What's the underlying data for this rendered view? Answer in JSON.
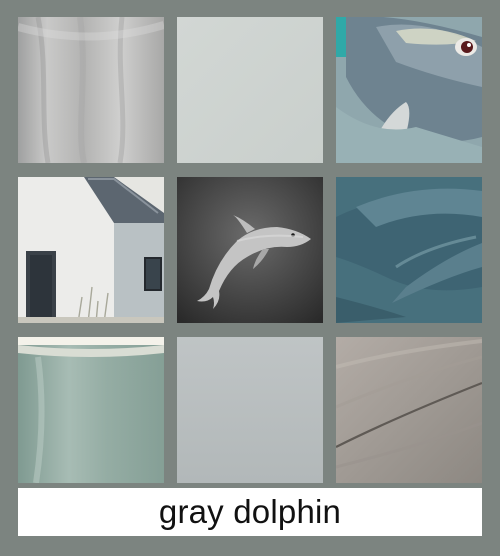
{
  "caption": {
    "text": "gray dolphin"
  },
  "colors": {
    "frame": "#7c8480",
    "caption_bg": "#ffffff",
    "caption_text": "#111111"
  },
  "tiles": [
    {
      "name": "fabric-tile",
      "icon": "gray-cloth"
    },
    {
      "name": "solid-swatch-light",
      "icon": "pale-gray-swatch"
    },
    {
      "name": "cartoon-dolphin-tile",
      "icon": "dolphin-face"
    },
    {
      "name": "cottage-tile",
      "icon": "white-house"
    },
    {
      "name": "jumping-dolphin-tile",
      "icon": "dolphin"
    },
    {
      "name": "underwater-dolphin-tile",
      "icon": "dolphin-body"
    },
    {
      "name": "ceramic-cup-tile",
      "icon": "cup"
    },
    {
      "name": "solid-swatch-gray",
      "icon": "gray-swatch"
    },
    {
      "name": "wood-grain-tile",
      "icon": "wood-texture"
    }
  ]
}
